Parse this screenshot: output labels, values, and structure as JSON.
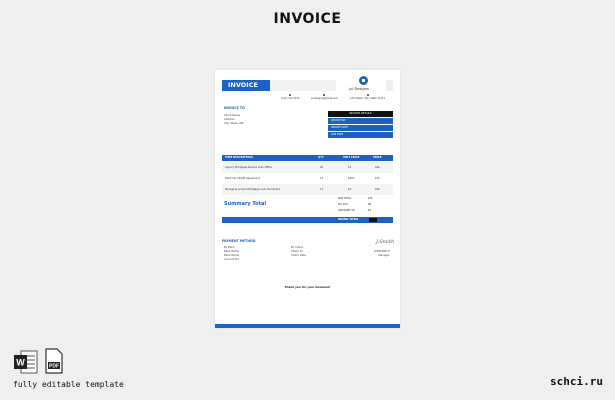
{
  "page_title": "INVOICE",
  "invoice": {
    "title": "INVOICE",
    "company_name": "Jul Designs",
    "contacts": [
      {
        "icon": "phone-icon",
        "text": "(111) 111-1111"
      },
      {
        "icon": "email-icon",
        "text": "juldesigns@gmail.com"
      },
      {
        "icon": "location-icon",
        "text": "123 Street, City, State 11111"
      }
    ],
    "bill_to_label": "INVOICE TO",
    "bill_to_lines": [
      "Client Name",
      "Address",
      "City, State, ZIP"
    ],
    "details_header": "INVOICE DETAILS",
    "details_rows": [
      "INVOICE NO.",
      "INVOICE DATE",
      "DUE DATE"
    ],
    "table_headers": {
      "desc": "ITEM DESCRIPTION",
      "qty": "QTY",
      "unit": "UNIT PRICE",
      "price": "PRICE"
    },
    "items": [
      {
        "desc": "Agency Mortgage Service Loan Office",
        "qty": "20",
        "unit": "$3",
        "price": "$60"
      },
      {
        "desc": "2020 Car LEASE Agreement",
        "qty": "15",
        "unit": "$300",
        "price": "$75"
      },
      {
        "desc": "Managing project Mortgage Loan Document",
        "qty": "15",
        "unit": "$4",
        "price": "$60"
      }
    ],
    "summary_label": "Summary Total",
    "summary_rows": [
      {
        "label": "SUB TOTAL",
        "value": "$75"
      },
      {
        "label": "Tax 10%",
        "value": "$8"
      },
      {
        "label": "DISCOUNT 5%",
        "value": "$3"
      }
    ],
    "grand_total_label": "GRAND TOTAL",
    "payment_title": "PAYMENT METHOD",
    "payment_col1": [
      "By Bank",
      "Bank Name",
      "Bank Name",
      "Account No"
    ],
    "payment_col2": [
      "By Check",
      "Check To",
      "Check Date"
    ],
    "signature": "J.Smith",
    "signature_lines": [
      "JOHN SMITH",
      "Manager"
    ],
    "thanks": "Thank you for your business!"
  },
  "footer": {
    "note": "fully editable template",
    "site": "schci.ru",
    "word_icon": "word-icon",
    "pdf_icon": "pdf-icon",
    "pdf_label": "PDF"
  }
}
